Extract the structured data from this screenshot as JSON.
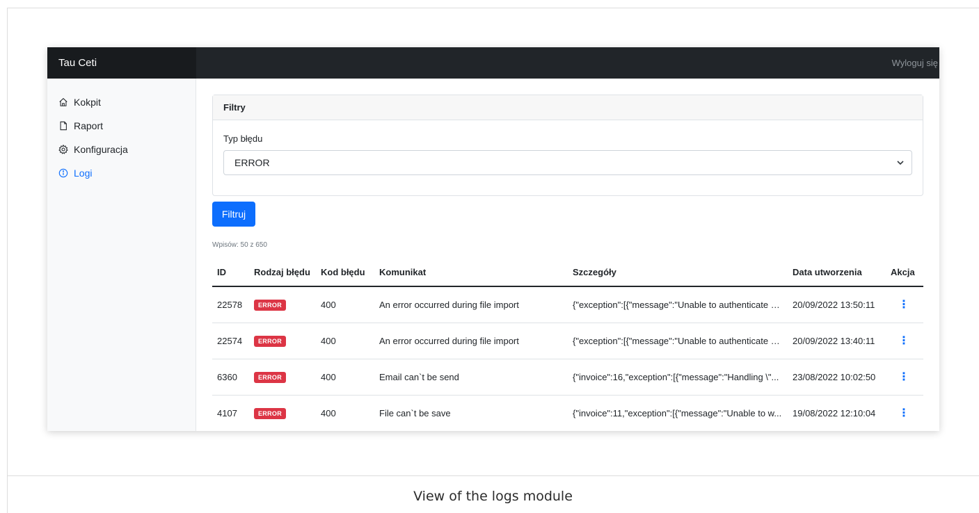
{
  "caption": "View of the logs module",
  "topbar": {
    "brand": "Tau Ceti",
    "logout": "Wyloguj się"
  },
  "sidebar": {
    "items": [
      {
        "label": "Kokpit",
        "icon": "home-icon"
      },
      {
        "label": "Raport",
        "icon": "file-icon"
      },
      {
        "label": "Konfiguracja",
        "icon": "gear-icon"
      },
      {
        "label": "Logi",
        "icon": "info-icon",
        "active": true
      }
    ]
  },
  "filters": {
    "title": "Filtry",
    "error_type_label": "Typ błędu",
    "error_type_value": "ERROR",
    "submit_label": "Filtruj"
  },
  "count_text": "Wpisów: 50 z 650",
  "table": {
    "headers": {
      "id": "ID",
      "type": "Rodzaj błędu",
      "code": "Kod błędu",
      "message": "Komunikat",
      "details": "Szczegóły",
      "created": "Data utworzenia",
      "action": "Akcja"
    },
    "rows": [
      {
        "id": "22578",
        "type": "ERROR",
        "code": "400",
        "message": "An error occurred during file import",
        "details": "{\"exception\":[{\"message\":\"Unable to authenticate u...",
        "created": "20/09/2022 13:50:11",
        "action": "⋮"
      },
      {
        "id": "22574",
        "type": "ERROR",
        "code": "400",
        "message": "An error occurred during file import",
        "details": "{\"exception\":[{\"message\":\"Unable to authenticate u...",
        "created": "20/09/2022 13:40:11",
        "action": "⋮"
      },
      {
        "id": "6360",
        "type": "ERROR",
        "code": "400",
        "message": "Email can`t be send",
        "details": "{\"invoice\":16,\"exception\":[{\"message\":\"Handling \\\"...",
        "created": "23/08/2022 10:02:50",
        "action": "⋮"
      },
      {
        "id": "4107",
        "type": "ERROR",
        "code": "400",
        "message": "File can`t be save",
        "details": "{\"invoice\":11,\"exception\":[{\"message\":\"Unable to w...",
        "created": "19/08/2022 12:10:04",
        "action": "⋮"
      }
    ]
  },
  "colors": {
    "primary": "#0d6efd",
    "danger": "#dc3545",
    "topbar": "#212529"
  }
}
